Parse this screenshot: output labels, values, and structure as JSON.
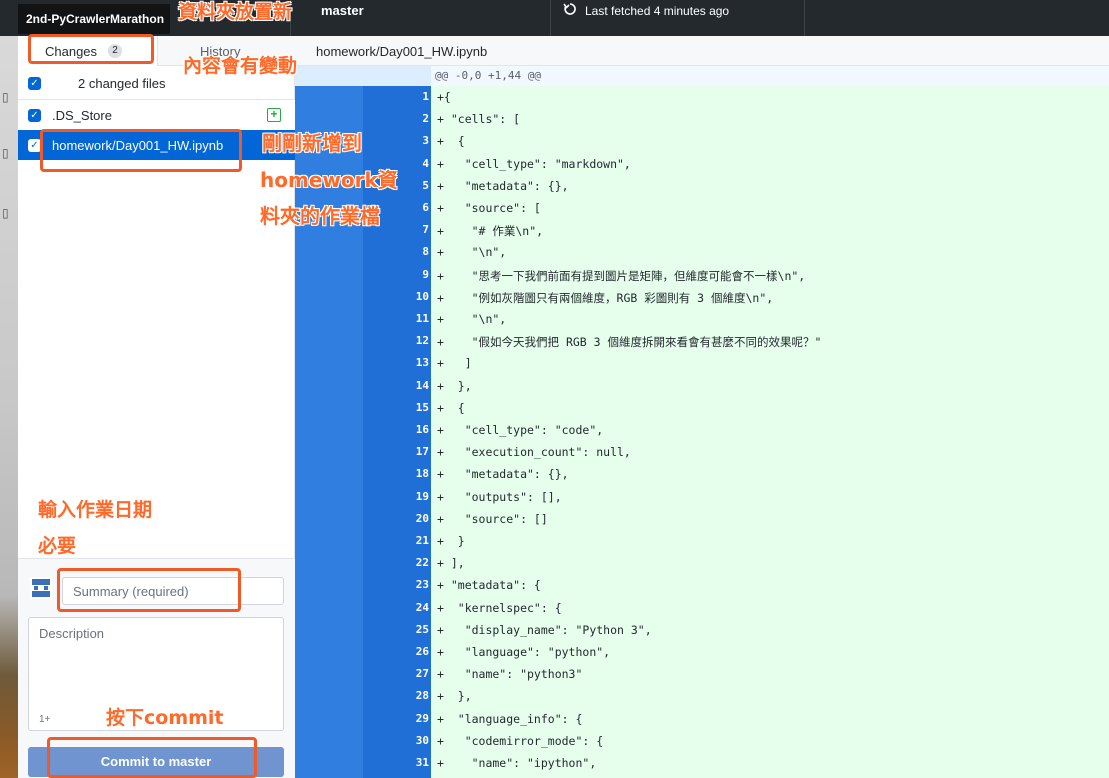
{
  "toolbar": {
    "repo_tag": "2nd-PyCrawlerMarathon",
    "repo_partial": "athon",
    "branch": "master",
    "fetch_status": "Last fetched 4 minutes ago"
  },
  "tabs": {
    "changes_label": "Changes",
    "changes_count": "2",
    "history_label": "History",
    "diff_path": "homework/Day001_HW.ipynb"
  },
  "sidebar": {
    "files_count": "2 changed files",
    "files": [
      {
        "name": ".DS_Store",
        "status": "+"
      },
      {
        "name": "homework/Day001_HW.ipynb"
      }
    ],
    "summary_placeholder": "Summary (required)",
    "description_placeholder": "Description",
    "coauthor_glyph": "1+",
    "commit_label": "Commit to master"
  },
  "diff": {
    "hunk_header": "@@ -0,0 +1,44 @@",
    "lines": [
      {
        "num": "1",
        "text": "+{"
      },
      {
        "num": "2",
        "text": "+ \"cells\": ["
      },
      {
        "num": "3",
        "text": "+  {"
      },
      {
        "num": "4",
        "text": "+   \"cell_type\": \"markdown\","
      },
      {
        "num": "5",
        "text": "+   \"metadata\": {},"
      },
      {
        "num": "6",
        "text": "+   \"source\": ["
      },
      {
        "num": "7",
        "text": "+    \"# 作業\\n\","
      },
      {
        "num": "8",
        "text": "+    \"\\n\","
      },
      {
        "num": "9",
        "text": "+    \"思考一下我們前面有提到圖片是矩陣，但維度可能會不一樣\\n\","
      },
      {
        "num": "10",
        "text": "+    \"例如灰階圖只有兩個維度，RGB 彩圖則有 3 個維度\\n\","
      },
      {
        "num": "11",
        "text": "+    \"\\n\","
      },
      {
        "num": "12",
        "text": "+    \"假如今天我們把 RGB 3 個維度拆開來看會有甚麼不同的效果呢？\""
      },
      {
        "num": "13",
        "text": "+   ]"
      },
      {
        "num": "14",
        "text": "+  },"
      },
      {
        "num": "15",
        "text": "+  {"
      },
      {
        "num": "16",
        "text": "+   \"cell_type\": \"code\","
      },
      {
        "num": "17",
        "text": "+   \"execution_count\": null,"
      },
      {
        "num": "18",
        "text": "+   \"metadata\": {},"
      },
      {
        "num": "19",
        "text": "+   \"outputs\": [],"
      },
      {
        "num": "20",
        "text": "+   \"source\": []"
      },
      {
        "num": "21",
        "text": "+  }"
      },
      {
        "num": "22",
        "text": "+ ],"
      },
      {
        "num": "23",
        "text": "+ \"metadata\": {"
      },
      {
        "num": "24",
        "text": "+  \"kernelspec\": {"
      },
      {
        "num": "25",
        "text": "+   \"display_name\": \"Python 3\","
      },
      {
        "num": "26",
        "text": "+   \"language\": \"python\","
      },
      {
        "num": "27",
        "text": "+   \"name\": \"python3\""
      },
      {
        "num": "28",
        "text": "+  },"
      },
      {
        "num": "29",
        "text": "+  \"language_info\": {"
      },
      {
        "num": "30",
        "text": "+   \"codemirror_mode\": {"
      },
      {
        "num": "31",
        "text": "+    \"name\": \"ipython\","
      }
    ]
  },
  "annotations": {
    "folder_note_1": "資料夾放置新",
    "folder_note_2": "內容會有變動",
    "file_note_1": "剛剛新增到",
    "file_note_2": "homework資",
    "file_note_3": "料夾的作業檔",
    "date_note_1": "輸入作業日期",
    "date_note_2": "必要",
    "commit_note": "按下commit"
  },
  "colors": {
    "toolbar": "#24292e",
    "accent_blue": "#0366d6",
    "added_line": "#e6ffed",
    "annotation": "#ff6a2a"
  }
}
